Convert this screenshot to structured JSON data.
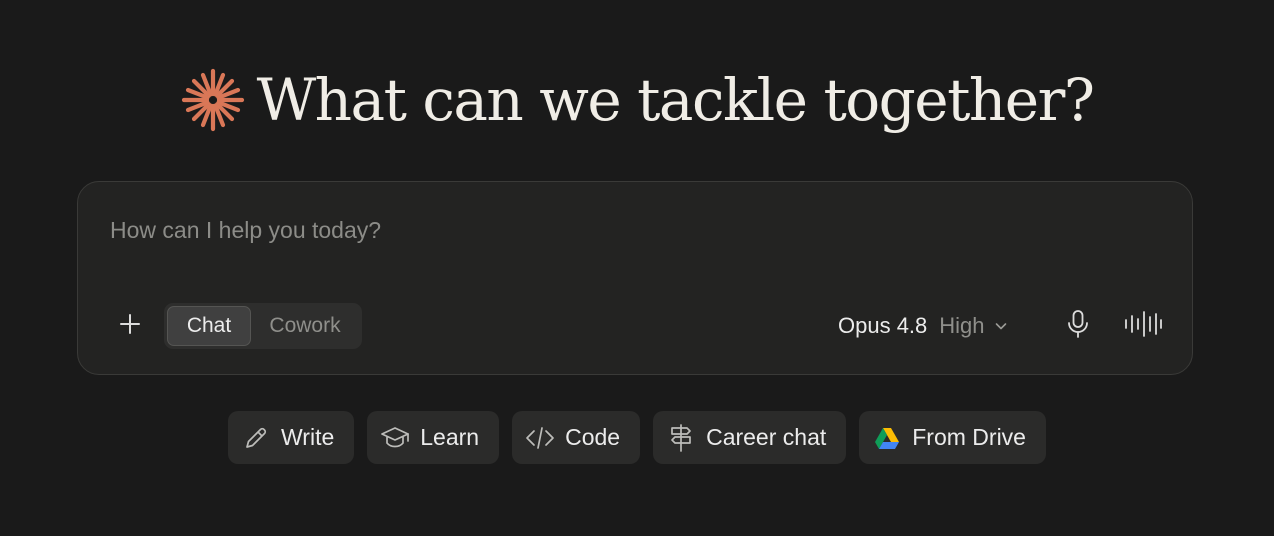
{
  "hero": {
    "title": "What can we tackle together?",
    "logo_icon": "sunburst-logo-icon",
    "accent": "#d97757"
  },
  "composer": {
    "placeholder": "How can I help you today?",
    "value": "",
    "add_icon": "plus-icon",
    "modes": [
      {
        "label": "Chat",
        "active": true
      },
      {
        "label": "Cowork",
        "active": false
      }
    ],
    "model": {
      "name": "Opus 4.8",
      "effort": "High",
      "chevron_icon": "chevron-down-icon"
    },
    "mic_icon": "microphone-icon",
    "voice_icon": "voice-waveform-icon"
  },
  "chips": [
    {
      "label": "Write",
      "icon": "pencil-icon"
    },
    {
      "label": "Learn",
      "icon": "graduation-cap-icon"
    },
    {
      "label": "Code",
      "icon": "code-brackets-icon"
    },
    {
      "label": "Career chat",
      "icon": "signpost-icon"
    },
    {
      "label": "From Drive",
      "icon": "google-drive-icon"
    }
  ]
}
